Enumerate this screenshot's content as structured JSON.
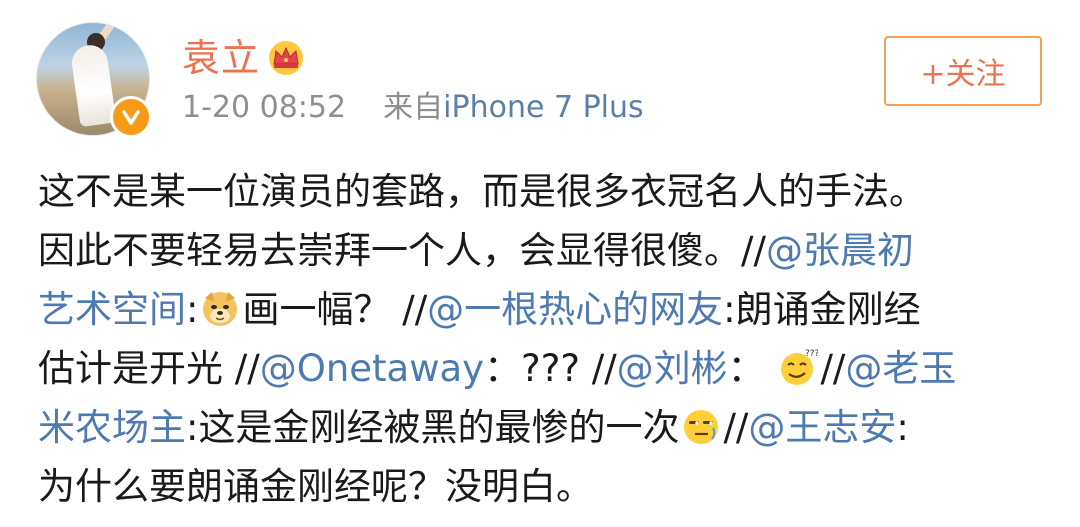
{
  "header": {
    "username": "袁立",
    "timestamp": "1-20 08:52",
    "source_prefix": "来自",
    "source_device": "iPhone 7 Plus",
    "follow_label": "+关注"
  },
  "post": {
    "lines": [
      [
        {
          "t": "text",
          "v": "这不是某一位演员的套路，而是很多衣冠名人的手法。"
        }
      ],
      [
        {
          "t": "text",
          "v": "因此不要轻易去崇拜一个人，会显得很傻。//"
        },
        {
          "t": "mention",
          "v": "@张晨初"
        }
      ],
      [
        {
          "t": "mention",
          "v": "艺术空间"
        },
        {
          "t": "text",
          "v": ":"
        },
        {
          "t": "emoji",
          "v": "doge-emoji"
        },
        {
          "t": "text",
          "v": "画一幅？ //"
        },
        {
          "t": "mention",
          "v": "@一根热心的网友"
        },
        {
          "t": "text",
          "v": ":朗诵金刚经"
        }
      ],
      [
        {
          "t": "text",
          "v": "估计是开光 //"
        },
        {
          "t": "mention",
          "v": "@Onetaway"
        },
        {
          "t": "text",
          "v": "：??? //"
        },
        {
          "t": "mention",
          "v": "@刘彬"
        },
        {
          "t": "text",
          "v": "： "
        },
        {
          "t": "emoji",
          "v": "thinking-emoji"
        },
        {
          "t": "text",
          "v": "//"
        },
        {
          "t": "mention",
          "v": "@老玉"
        }
      ],
      [
        {
          "t": "mention",
          "v": "米农场主"
        },
        {
          "t": "text",
          "v": ":这是金刚经被黑的最惨的一次"
        },
        {
          "t": "emoji",
          "v": "side-eye-emoji"
        },
        {
          "t": "text",
          "v": "//"
        },
        {
          "t": "mention",
          "v": "@王志安"
        },
        {
          "t": "text",
          "v": ":"
        }
      ],
      [
        {
          "t": "text",
          "v": "为什么要朗诵金刚经呢？没明白。"
        }
      ]
    ]
  },
  "colors": {
    "username": "#eb7350",
    "mention": "#4d7ab0",
    "meta": "#8f8f8f",
    "follow_border": "#f5a05a",
    "badge": "#f59b16"
  }
}
